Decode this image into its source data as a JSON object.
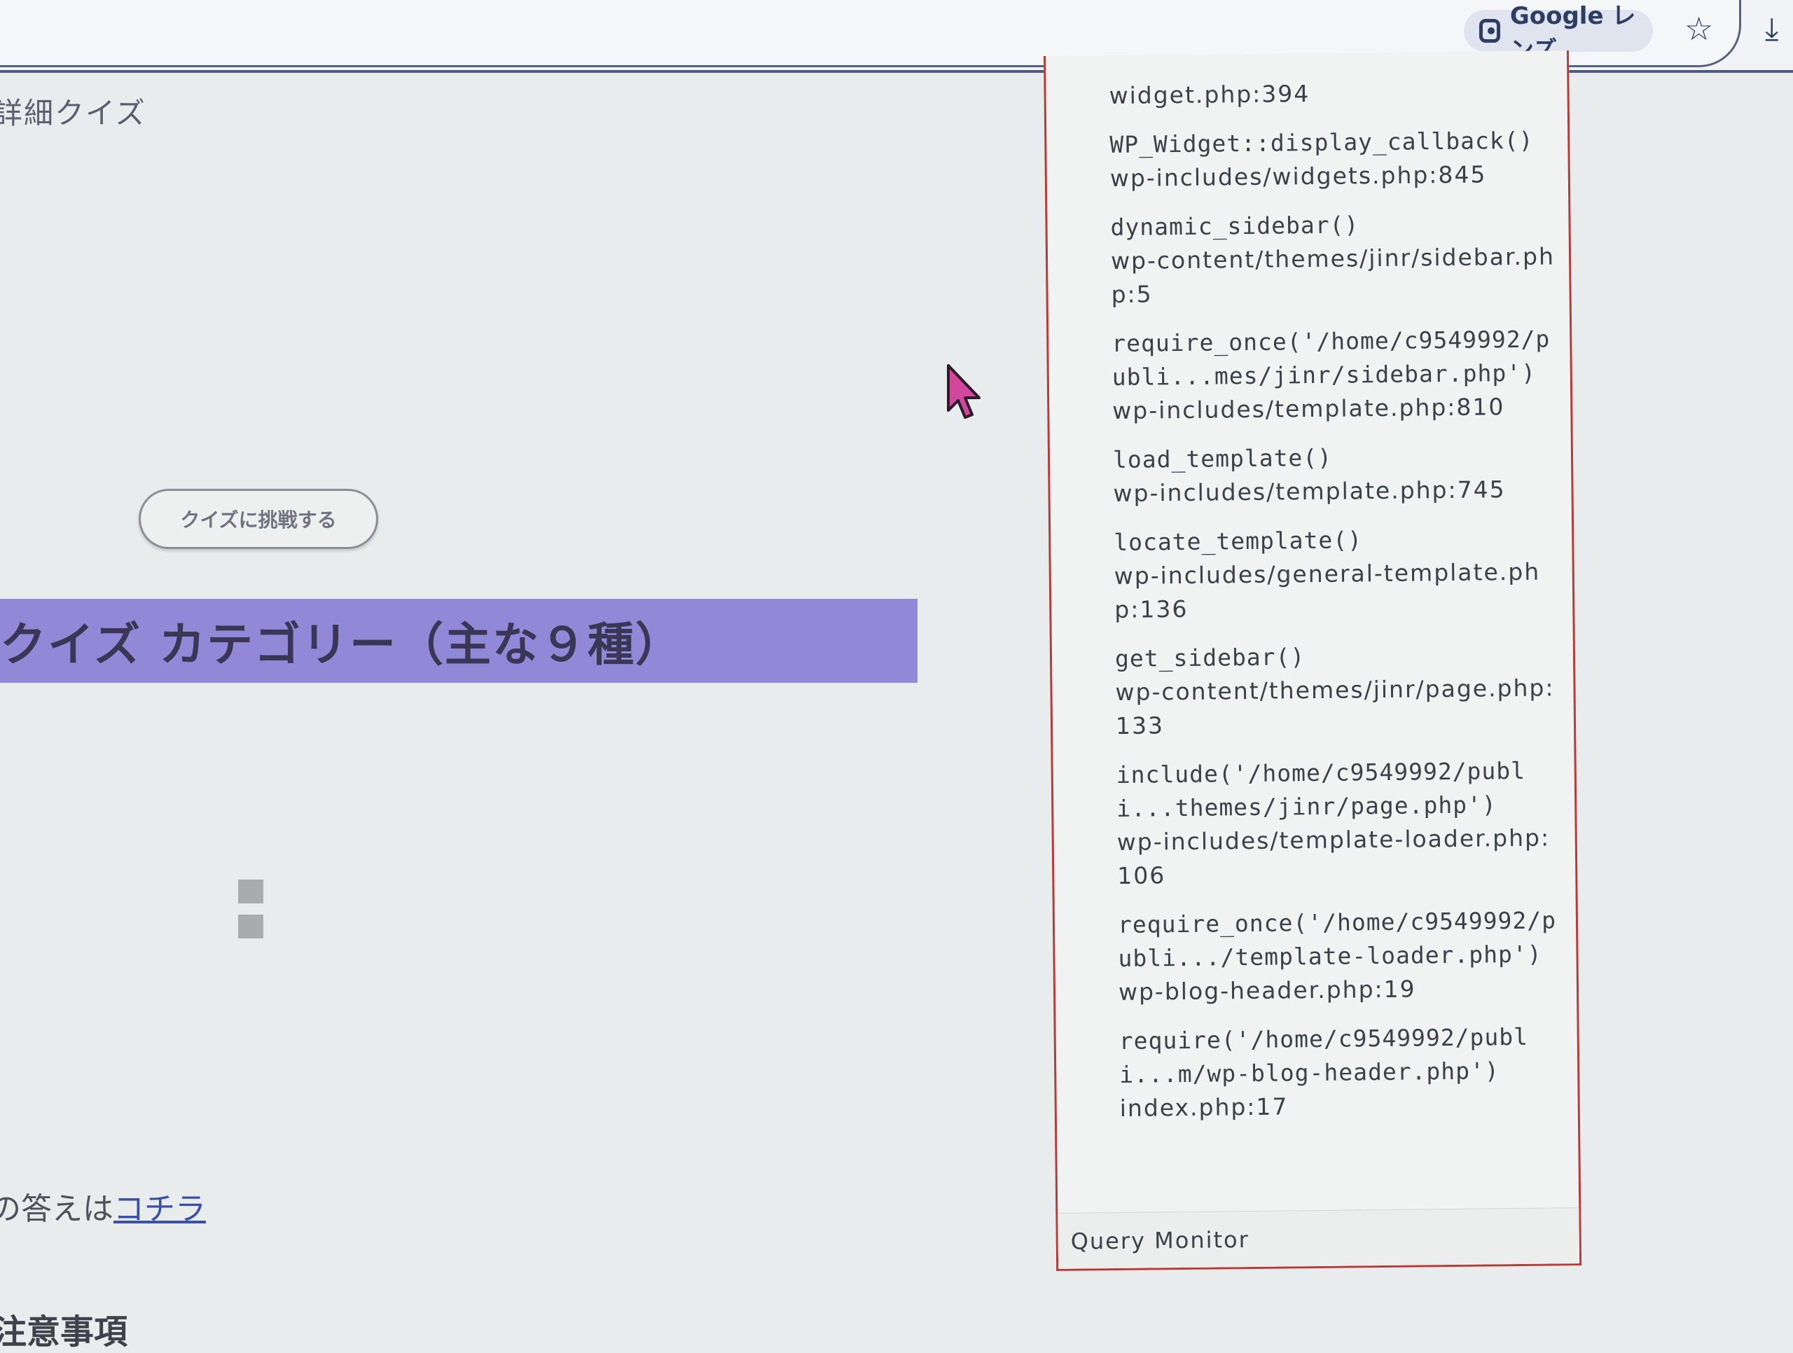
{
  "browser": {
    "lens_label": "Google レンズ",
    "icons": [
      "google-lens-icon",
      "bookmark-star-icon",
      "download-icon"
    ]
  },
  "page": {
    "top_heading": "詳細クイズ",
    "quiz_button_label": "クイズに挑戦する",
    "category_heading": "クイズ カテゴリー（主な９種）",
    "answer_prefix": "の答えは",
    "answer_link": "コチラ",
    "notes_heading": "注意事項"
  },
  "query_monitor": {
    "title": "Query Monitor",
    "trace": [
      {
        "fn": "",
        "file": "widget.php:394"
      },
      {
        "fn": "WP_Widget::display_callback()",
        "file": "wp-includes/widgets.php:845"
      },
      {
        "fn": "dynamic_sidebar()",
        "file": "wp-content/themes/jinr/sidebar.php:5"
      },
      {
        "fn": "require_once('/home/c9549992/publi...mes/jinr/sidebar.php')",
        "file": "wp-includes/template.php:810"
      },
      {
        "fn": "load_template()",
        "file": "wp-includes/template.php:745"
      },
      {
        "fn": "locate_template()",
        "file": "wp-includes/general-template.php:136"
      },
      {
        "fn": "get_sidebar()",
        "file": "wp-content/themes/jinr/page.php:133"
      },
      {
        "fn": "include('/home/c9549992/publi...themes/jinr/page.php')",
        "file": "wp-includes/template-loader.php:106"
      },
      {
        "fn": "require_once('/home/c9549992/publi.../template-loader.php')",
        "file": "wp-blog-header.php:19"
      },
      {
        "fn": "require('/home/c9549992/publi...m/wp-blog-header.php')",
        "file": "index.php:17"
      }
    ]
  },
  "colors": {
    "banner": "#9288d8",
    "panel_border": "#b73b3b",
    "cursor": "#d0479b",
    "link": "#3a4fa8"
  }
}
